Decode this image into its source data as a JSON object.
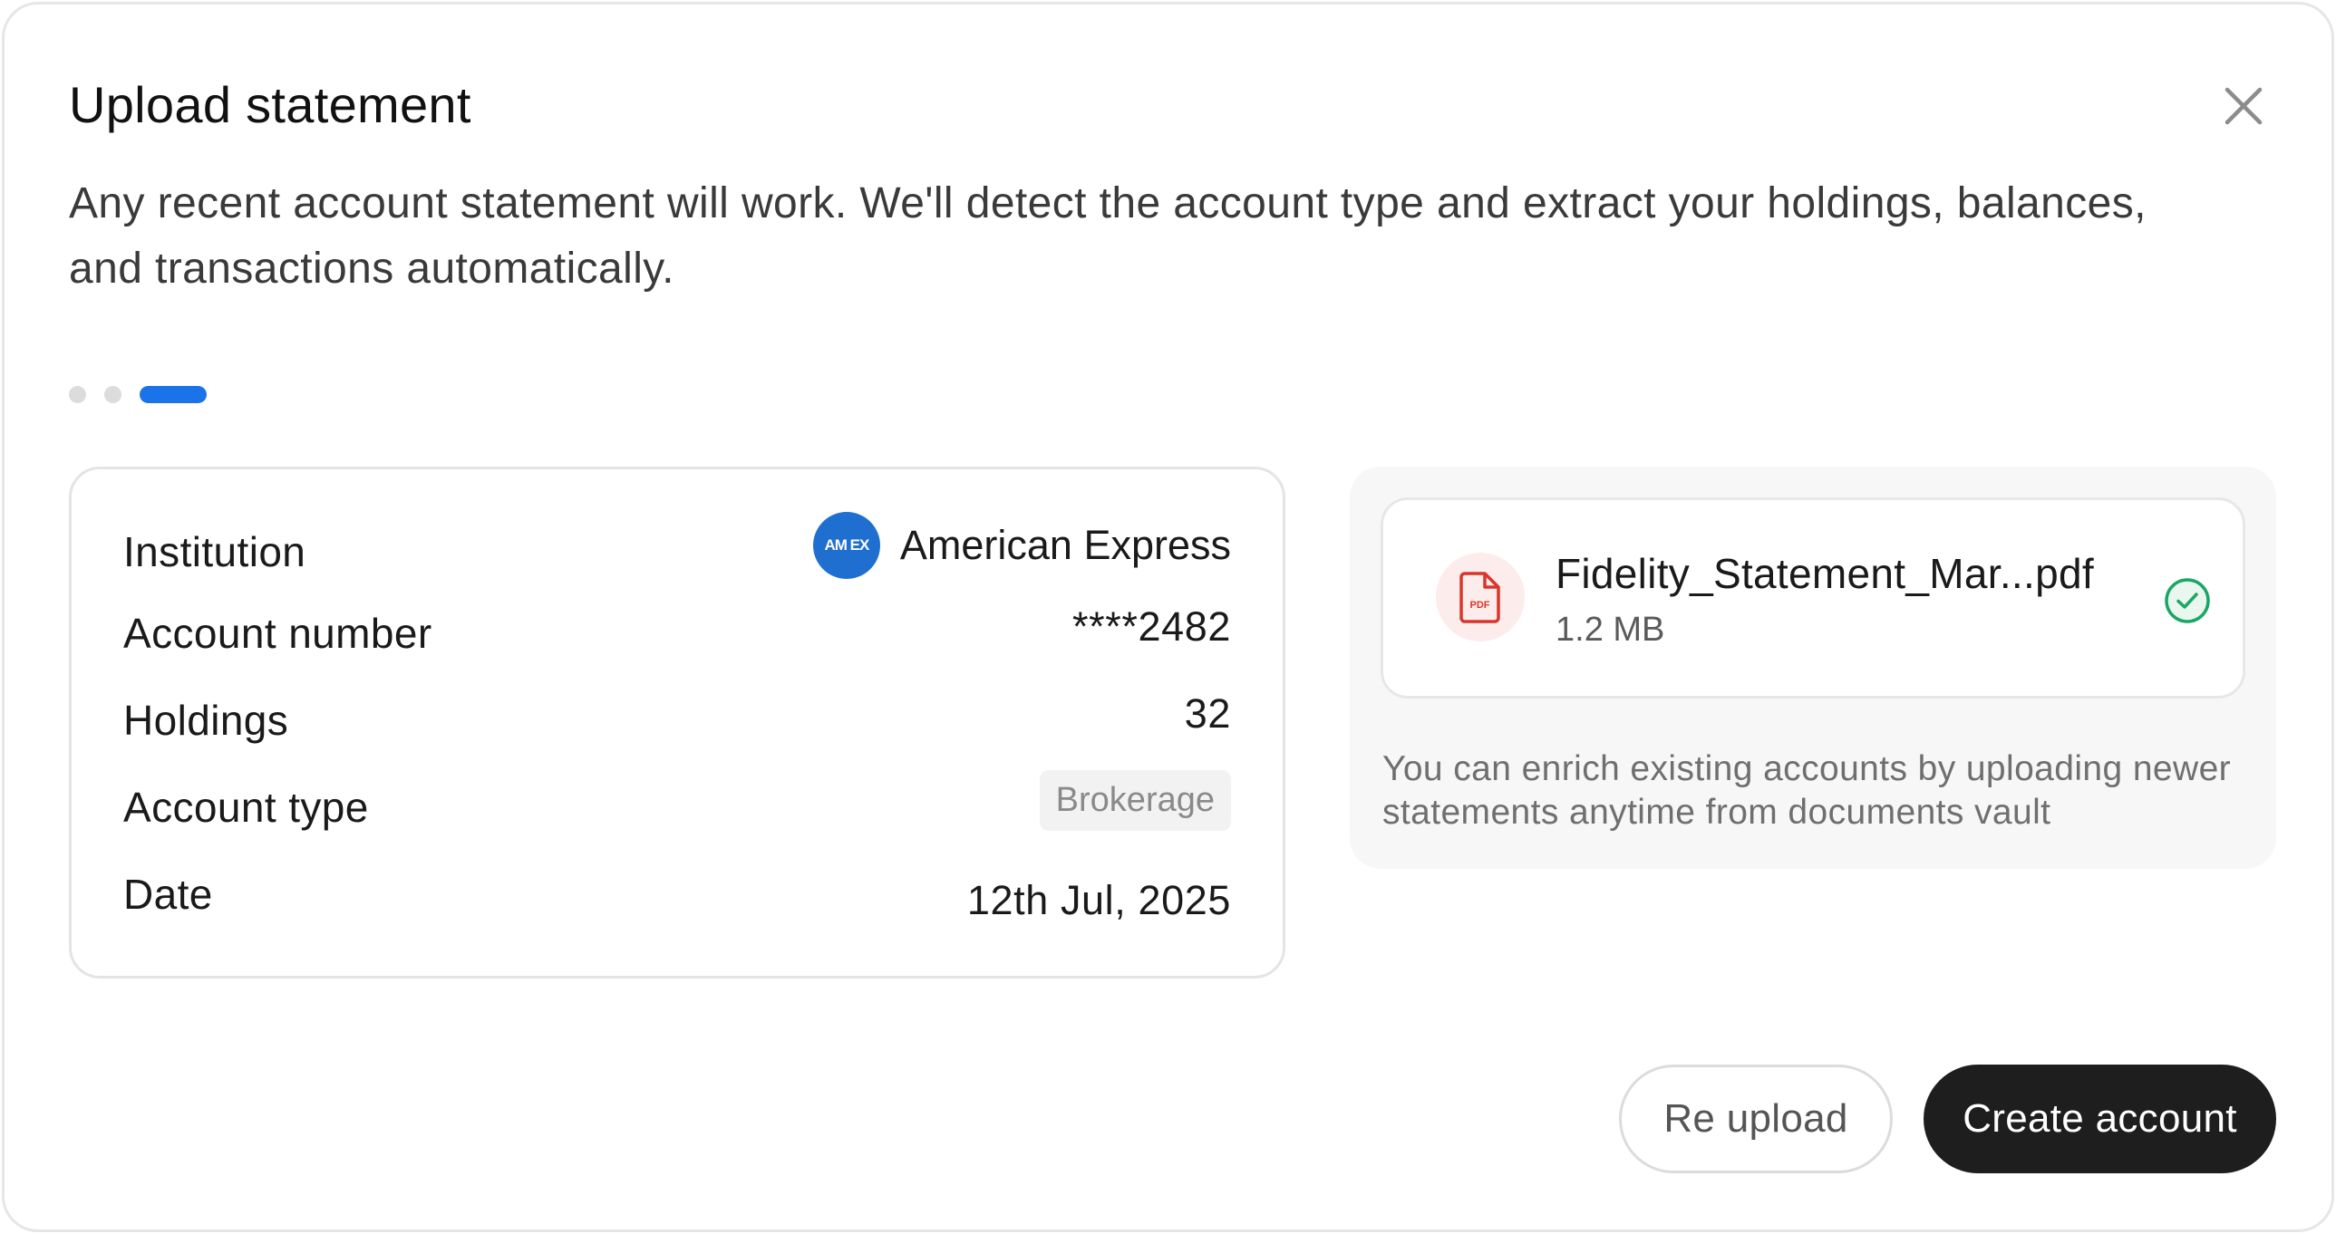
{
  "dialog": {
    "title": "Upload statement",
    "subtitle": "Any recent account statement will work. We'll detect the account type and extract your holdings, balances, and transactions automatically.",
    "close_icon": "close-icon"
  },
  "stepper": {
    "total_steps": 3,
    "current_step": 3,
    "active_color": "#1a73e8"
  },
  "details": {
    "institution": {
      "label": "Institution",
      "logo_text": "AM EX",
      "logo_color": "#1f6fd1",
      "value": "American Express"
    },
    "account_number": {
      "label": "Account number",
      "value": "****2482"
    },
    "holdings": {
      "label": "Holdings",
      "value": "32"
    },
    "account_type": {
      "label": "Account type",
      "value": "Brokerage"
    },
    "date": {
      "label": "Date",
      "value": "12th Jul, 2025"
    }
  },
  "file": {
    "name": "Fidelity_Statement_Mar...pdf",
    "size": "1.2 MB",
    "type_icon": "pdf-file-icon",
    "status_icon": "check-circle-icon",
    "status_color": "#1aa765",
    "hint": "You can enrich existing accounts by uploading newer statements anytime from documents vault"
  },
  "actions": {
    "reupload_label": "Re upload",
    "create_label": "Create account"
  }
}
